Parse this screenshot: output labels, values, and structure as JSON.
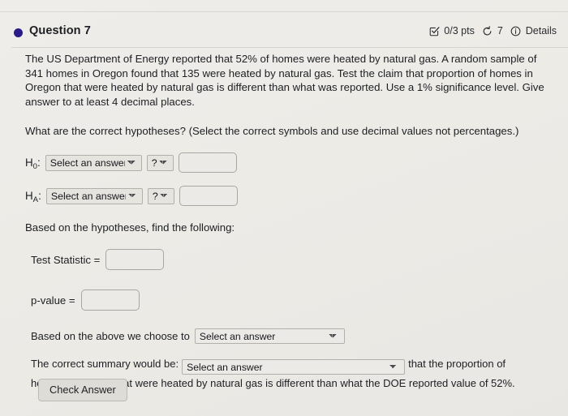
{
  "header": {
    "question_label": "Question 7",
    "bullet_color": "#2a1a8a",
    "points": "0/3 pts",
    "attempts": "7",
    "details_label": "Details",
    "checkbox_icon": "checkbox-check-icon",
    "retry_icon": "counterclockwise-arrow-icon",
    "info_icon": "info-circle-icon"
  },
  "prompt": {
    "text": "The US Department of Energy reported that 52% of homes were heated by natural gas. A random sample of 341 homes in Oregon found that 135 were heated by natural gas. Test the claim that proportion of homes in Oregon that were heated by natural gas is different than what was reported. Use a 1% significance level. Give answer to at least 4 decimal places."
  },
  "sub_question": {
    "text": "What are the correct hypotheses? (Select the correct symbols and use decimal values not percentages.)"
  },
  "hypotheses": {
    "null": {
      "label_base": "H",
      "label_sub": "0",
      "label_colon": ":",
      "parameter_select": "Select an answer",
      "symbol_select": "?",
      "value": "",
      "value_placeholder": ""
    },
    "alternative": {
      "label_base": "H",
      "label_sub": "A",
      "label_colon": ":",
      "parameter_select": "Select an answer",
      "symbol_select": "?",
      "value": "",
      "value_placeholder": ""
    }
  },
  "find_following": {
    "heading": "Based on the hypotheses, find the following:",
    "test_statistic_label": "Test Statistic =",
    "test_statistic_value": "",
    "p_value_label": "p-value =",
    "p_value_value": ""
  },
  "decision": {
    "lead_text": "Based on the above we choose to",
    "select_value": "Select an answer"
  },
  "summary": {
    "lead_text": "The correct summary would be:",
    "select_value": "Select an answer",
    "tail_text": "that the proportion of",
    "line2_text": "homes in Oregon that were heated by natural gas is different than what the DOE reported value of 52%."
  },
  "actions": {
    "check_answer_label": "Check Answer"
  }
}
